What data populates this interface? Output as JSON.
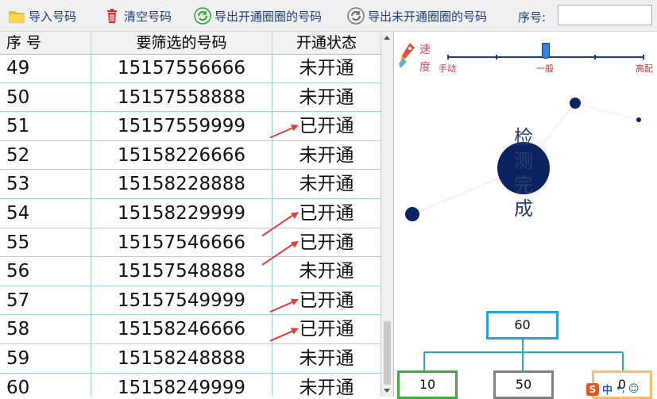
{
  "toolbar": {
    "import_label": "导入号码",
    "clear_label": "清空号码",
    "export_open_label": "导出开通圈圈的号码",
    "export_unopened_label": "导出未开通圈圈的号码",
    "seq_label": "序号:",
    "seq_value": ""
  },
  "table": {
    "headers": [
      "序 号",
      "要筛选的号码",
      "开通状态"
    ],
    "rows": [
      {
        "seq": "49",
        "number": "15157556666",
        "status": "未开通"
      },
      {
        "seq": "50",
        "number": "15157558888",
        "status": "未开通"
      },
      {
        "seq": "51",
        "number": "15157559999",
        "status": "已开通"
      },
      {
        "seq": "52",
        "number": "15158226666",
        "status": "未开通"
      },
      {
        "seq": "53",
        "number": "15158228888",
        "status": "未开通"
      },
      {
        "seq": "54",
        "number": "15158229999",
        "status": "已开通"
      },
      {
        "seq": "55",
        "number": "15157546666",
        "status": "已开通"
      },
      {
        "seq": "56",
        "number": "15157548888",
        "status": "未开通"
      },
      {
        "seq": "57",
        "number": "15157549999",
        "status": "已开通"
      },
      {
        "seq": "58",
        "number": "15158246666",
        "status": "已开通"
      },
      {
        "seq": "59",
        "number": "15158248888",
        "status": "未开通"
      },
      {
        "seq": "60",
        "number": "15158249999",
        "status": "未开通"
      }
    ]
  },
  "speed": {
    "label_1": "速",
    "label_2": "度",
    "ticks": [
      "手动",
      "一般",
      "高配"
    ],
    "level": 0.5
  },
  "status_text": [
    "检",
    "测",
    "完",
    "成"
  ],
  "tree": {
    "root": "60",
    "children": [
      "10",
      "50",
      "0"
    ]
  },
  "ime": {
    "text": "中"
  },
  "colors": {
    "toolbar_text": "#1e3c78",
    "grid_line": "#9ed3e3",
    "arrow": "#e53935",
    "node_dark": "#0d2463",
    "root_border": "#27a3d6",
    "child1_border": "#3faa3f",
    "child2_border": "#808080",
    "child3_border": "#f0c070"
  }
}
